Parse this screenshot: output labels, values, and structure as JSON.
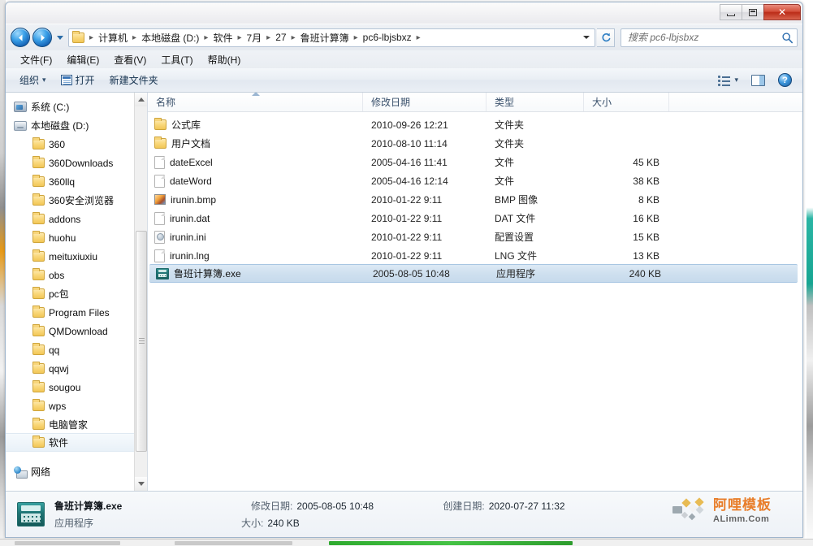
{
  "window": {
    "title": "",
    "buttons": {
      "minimize": "minimize-button",
      "maximize": "maximize-button",
      "close": "✕"
    }
  },
  "address": {
    "back_icon": "back-arrow-icon",
    "forward_icon": "forward-arrow-icon",
    "recent_icon": "recent-pages-dropdown-icon",
    "breadcrumb": [
      "计算机",
      "本地磁盘 (D:)",
      "软件",
      "7月",
      "27",
      "鲁班计算簿",
      "pc6-lbjsbxz"
    ],
    "separator": "▸",
    "refresh_icon": "refresh-icon",
    "dropdown_icon": "chevron-down-icon"
  },
  "search": {
    "placeholder": "搜索 pc6-lbjsbxz",
    "value": "",
    "icon": "search-icon"
  },
  "menubar": [
    {
      "label": "文件(F)",
      "key": "F"
    },
    {
      "label": "编辑(E)",
      "key": "E"
    },
    {
      "label": "查看(V)",
      "key": "V"
    },
    {
      "label": "工具(T)",
      "key": "T"
    },
    {
      "label": "帮助(H)",
      "key": "H"
    }
  ],
  "toolbar": {
    "organize": "组织",
    "organize_caret": "▾",
    "open": "打开",
    "open_icon": "open-file-icon",
    "new_folder": "新建文件夹",
    "view_icon": "view-list-icon",
    "view_caret": "▾",
    "preview_icon": "preview-pane-icon",
    "help_icon": "help-icon",
    "help_glyph": "?"
  },
  "sidebar": {
    "items": [
      {
        "label": "系统 (C:)",
        "icon": "system-drive-icon",
        "type": "drive-sys",
        "indent": false,
        "selected": false
      },
      {
        "label": "本地磁盘 (D:)",
        "icon": "local-disk-icon",
        "type": "drive",
        "indent": false,
        "selected": false
      },
      {
        "label": "360",
        "icon": "folder-icon",
        "type": "folder",
        "indent": true,
        "selected": false
      },
      {
        "label": "360Downloads",
        "icon": "folder-icon",
        "type": "folder",
        "indent": true,
        "selected": false
      },
      {
        "label": "360llq",
        "icon": "folder-icon",
        "type": "folder",
        "indent": true,
        "selected": false
      },
      {
        "label": "360安全浏览器",
        "icon": "folder-icon",
        "type": "folder",
        "indent": true,
        "selected": false
      },
      {
        "label": "addons",
        "icon": "folder-icon",
        "type": "folder",
        "indent": true,
        "selected": false
      },
      {
        "label": "huohu",
        "icon": "folder-icon",
        "type": "folder",
        "indent": true,
        "selected": false
      },
      {
        "label": "meituxiuxiu",
        "icon": "folder-icon",
        "type": "folder",
        "indent": true,
        "selected": false
      },
      {
        "label": "obs",
        "icon": "folder-icon",
        "type": "folder",
        "indent": true,
        "selected": false
      },
      {
        "label": "pc包",
        "icon": "folder-icon",
        "type": "folder",
        "indent": true,
        "selected": false
      },
      {
        "label": "Program Files",
        "icon": "folder-icon",
        "type": "folder",
        "indent": true,
        "selected": false
      },
      {
        "label": "QMDownload",
        "icon": "folder-icon",
        "type": "folder",
        "indent": true,
        "selected": false
      },
      {
        "label": "qq",
        "icon": "folder-icon",
        "type": "folder",
        "indent": true,
        "selected": false
      },
      {
        "label": "qqwj",
        "icon": "folder-icon",
        "type": "folder",
        "indent": true,
        "selected": false
      },
      {
        "label": "sougou",
        "icon": "folder-icon",
        "type": "folder",
        "indent": true,
        "selected": false
      },
      {
        "label": "wps",
        "icon": "folder-icon",
        "type": "folder",
        "indent": true,
        "selected": false
      },
      {
        "label": "电脑管家",
        "icon": "folder-icon",
        "type": "folder",
        "indent": true,
        "selected": false
      },
      {
        "label": "软件",
        "icon": "folder-icon",
        "type": "folder",
        "indent": true,
        "selected": true
      }
    ],
    "network": {
      "label": "网络",
      "icon": "network-icon"
    },
    "scroll_up_icon": "scroll-up-arrow-icon",
    "scroll_down_icon": "scroll-down-arrow-icon"
  },
  "filelist": {
    "columns": [
      {
        "label": "名称",
        "key": "name"
      },
      {
        "label": "修改日期",
        "key": "date"
      },
      {
        "label": "类型",
        "key": "type"
      },
      {
        "label": "大小",
        "key": "size"
      }
    ],
    "sort_indicator": "ascending",
    "rows": [
      {
        "name": "公式库",
        "date": "2010-09-26 12:21",
        "type": "文件夹",
        "size": "",
        "icon": "folder-icon",
        "kind": "folder",
        "selected": false
      },
      {
        "name": "用户文档",
        "date": "2010-08-10 11:14",
        "type": "文件夹",
        "size": "",
        "icon": "folder-icon",
        "kind": "folder",
        "selected": false
      },
      {
        "name": "dateExcel",
        "date": "2005-04-16 11:41",
        "type": "文件",
        "size": "45 KB",
        "icon": "file-icon",
        "kind": "file",
        "selected": false
      },
      {
        "name": "dateWord",
        "date": "2005-04-16 12:14",
        "type": "文件",
        "size": "38 KB",
        "icon": "file-icon",
        "kind": "file",
        "selected": false
      },
      {
        "name": "irunin.bmp",
        "date": "2010-01-22 9:11",
        "type": "BMP 图像",
        "size": "8 KB",
        "icon": "bmp-image-icon",
        "kind": "bmp",
        "selected": false
      },
      {
        "name": "irunin.dat",
        "date": "2010-01-22 9:11",
        "type": "DAT 文件",
        "size": "16 KB",
        "icon": "file-icon",
        "kind": "file",
        "selected": false
      },
      {
        "name": "irunin.ini",
        "date": "2010-01-22 9:11",
        "type": "配置设置",
        "size": "15 KB",
        "icon": "ini-config-icon",
        "kind": "ini",
        "selected": false
      },
      {
        "name": "irunin.lng",
        "date": "2010-01-22 9:11",
        "type": "LNG 文件",
        "size": "13 KB",
        "icon": "file-icon",
        "kind": "file",
        "selected": false
      },
      {
        "name": "鲁班计算簿.exe",
        "date": "2005-08-05 10:48",
        "type": "应用程序",
        "size": "240 KB",
        "icon": "application-icon",
        "kind": "exe",
        "selected": true
      }
    ]
  },
  "details": {
    "icon": "calculator-application-icon",
    "name": "鲁班计算簿.exe",
    "type": "应用程序",
    "modified_label": "修改日期:",
    "modified_value": "2005-08-05 10:48",
    "size_label": "大小:",
    "size_value": "240 KB",
    "created_label": "创建日期:",
    "created_value": "2020-07-27 11:32"
  },
  "watermark": {
    "cn": "阿哩模板",
    "en": "ALimm.Com"
  },
  "colors": {
    "selection": "#cfe0ef",
    "accent": "#3aa0e8",
    "watermark_orange": "#e8771f",
    "taskbar_green": "#2faa2f"
  }
}
